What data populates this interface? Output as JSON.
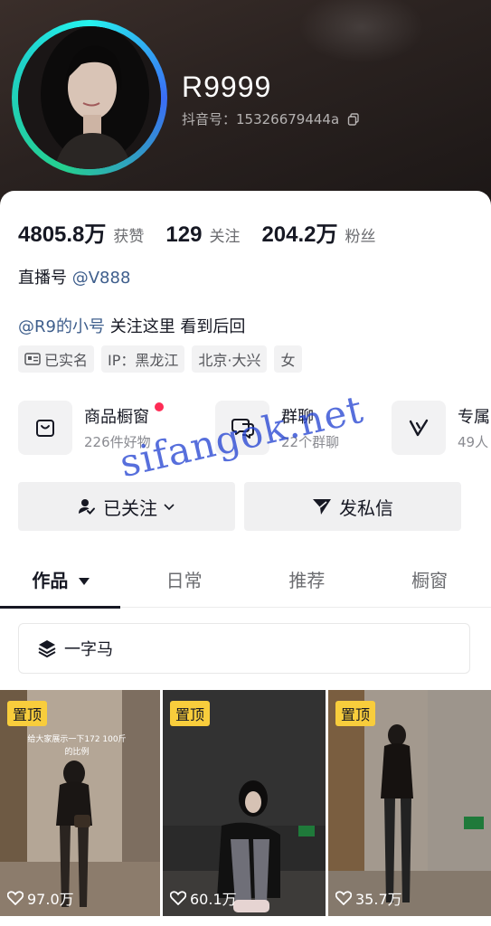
{
  "profile": {
    "nickname": "R9999",
    "douyin_id": "抖音号：15326679444a"
  },
  "stats": [
    {
      "value": "4805.8万",
      "label": "获赞"
    },
    {
      "value": "129",
      "label": "关注"
    },
    {
      "value": "204.2万",
      "label": "粉丝"
    }
  ],
  "live": {
    "prefix": "直播号 ",
    "handle": "@V888"
  },
  "bio": {
    "handle": "@R9的小号",
    "text": " 关注这里 看到后回"
  },
  "tags": [
    "已实名",
    "IP：黑龙江",
    "北京·大兴",
    "女"
  ],
  "features": [
    {
      "title": "商品橱窗",
      "sub": "226件好物",
      "icon": "bag-icon"
    },
    {
      "title": "群聊",
      "sub": "22个群聊",
      "icon": "chat-bubbles-icon"
    },
    {
      "title": "专属",
      "sub": "49人",
      "icon": "v-badge-icon"
    }
  ],
  "actions": {
    "follow": "已关注",
    "message": "发私信"
  },
  "tabs": [
    "作品",
    "日常",
    "推荐",
    "橱窗"
  ],
  "collection": {
    "label": "一字马"
  },
  "videos": [
    {
      "pinned": "置顶",
      "likes": "97.0万",
      "overlay": "给大家展示一下172 100斤的比例"
    },
    {
      "pinned": "置顶",
      "likes": "60.1万"
    },
    {
      "pinned": "置顶",
      "likes": "35.7万"
    }
  ],
  "watermark": "sifangok.net",
  "colors": {
    "accent": "#fe2c55",
    "link": "#3e5e8c",
    "pin": "#f8cd3c"
  }
}
